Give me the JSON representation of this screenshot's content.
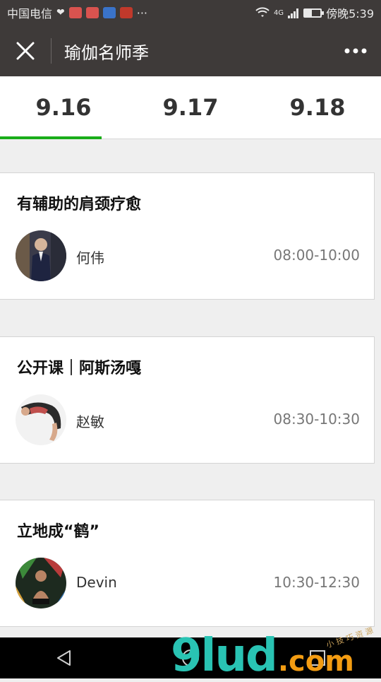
{
  "status_bar": {
    "carrier": "中国电信",
    "overflow": "···",
    "right_text": "傍晚5:39",
    "signal": "4G"
  },
  "header": {
    "title": "瑜伽名师季"
  },
  "tabs": [
    {
      "label": "9.16",
      "active": true
    },
    {
      "label": "9.17",
      "active": false
    },
    {
      "label": "9.18",
      "active": false
    }
  ],
  "courses": [
    {
      "title": "有辅助的肩颈疗愈",
      "teacher": "何伟",
      "time": "08:00-10:00"
    },
    {
      "title": "公开课｜阿斯汤嘎",
      "teacher": "赵敏",
      "time": "08:30-10:30"
    },
    {
      "title": "立地成“鹤”",
      "teacher": "Devin",
      "time": "10:30-12:30"
    }
  ],
  "watermark": {
    "main": "9lud",
    "com": ".com",
    "small": "小 技 巧 资 源"
  },
  "colors": {
    "header_bg": "#3e3a39",
    "accent": "#1aad19",
    "page_bg": "#efefef"
  }
}
